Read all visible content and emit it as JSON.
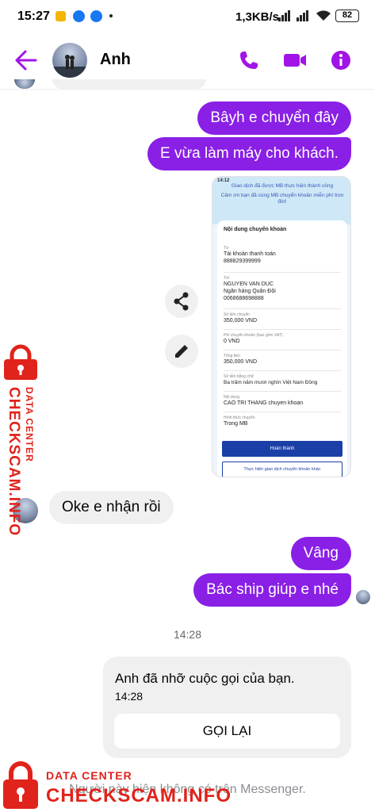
{
  "status_bar": {
    "time": "15:27",
    "net_speed": "1,3KB/s",
    "battery": "82"
  },
  "header": {
    "contact_name": "Anh",
    "accent_color": "#a114e8"
  },
  "messages": {
    "sent_1": "Bâyh e chuyển đây",
    "sent_2": "E vừa làm máy cho khách.",
    "received_1": "Oke e nhận rồi",
    "sent_3": "Vâng",
    "sent_4": "Bác ship giúp e nhé"
  },
  "receipt": {
    "time": "14:12",
    "note_line1": "Giao dịch đã được MB thực hiện thành công",
    "note_line2": "Cảm ơn bạn đã cùng MB chuyển khoản miễn phí trọn đời!",
    "card_title": "Nội dung chuyển khoản",
    "fields": [
      {
        "label": "Từ",
        "value": "Tài khoản thanh toán",
        "value2": "888829399999"
      },
      {
        "label": "Tới",
        "value": "NGUYEN VAN DUC",
        "value2": "Ngân hàng Quân Đội",
        "value3": "0068688698888"
      },
      {
        "label": "Số tiền chuyển",
        "value": "350,000 VND"
      },
      {
        "label": "Phí chuyển khoản (bao gồm VAT)",
        "value": "0 VND"
      },
      {
        "label": "Tổng tiền",
        "value": "350,000 VND"
      },
      {
        "label": "Số tiền bằng chữ",
        "value": "Ba trăm năm mươi nghìn Việt Nam Đồng"
      },
      {
        "label": "Nội dung",
        "value": "CAO TRI THANG chuyen khoan"
      },
      {
        "label": "Hình thức chuyển",
        "value": "Trong MB"
      }
    ],
    "primary_button": "Hoàn thành",
    "secondary_button": "Thực hiện giao dịch chuyển khoản khác"
  },
  "timestamp": "14:28",
  "call_card": {
    "text": "Anh đã nhỡ cuộc gọi của bạn.",
    "time": "14:28",
    "button": "GỌI LẠI"
  },
  "bottom_note": "Người này hiện không có trên Messenger.",
  "watermark": {
    "line1": "DATA CENTER",
    "line2": "CHECKSCAM.INFO"
  }
}
